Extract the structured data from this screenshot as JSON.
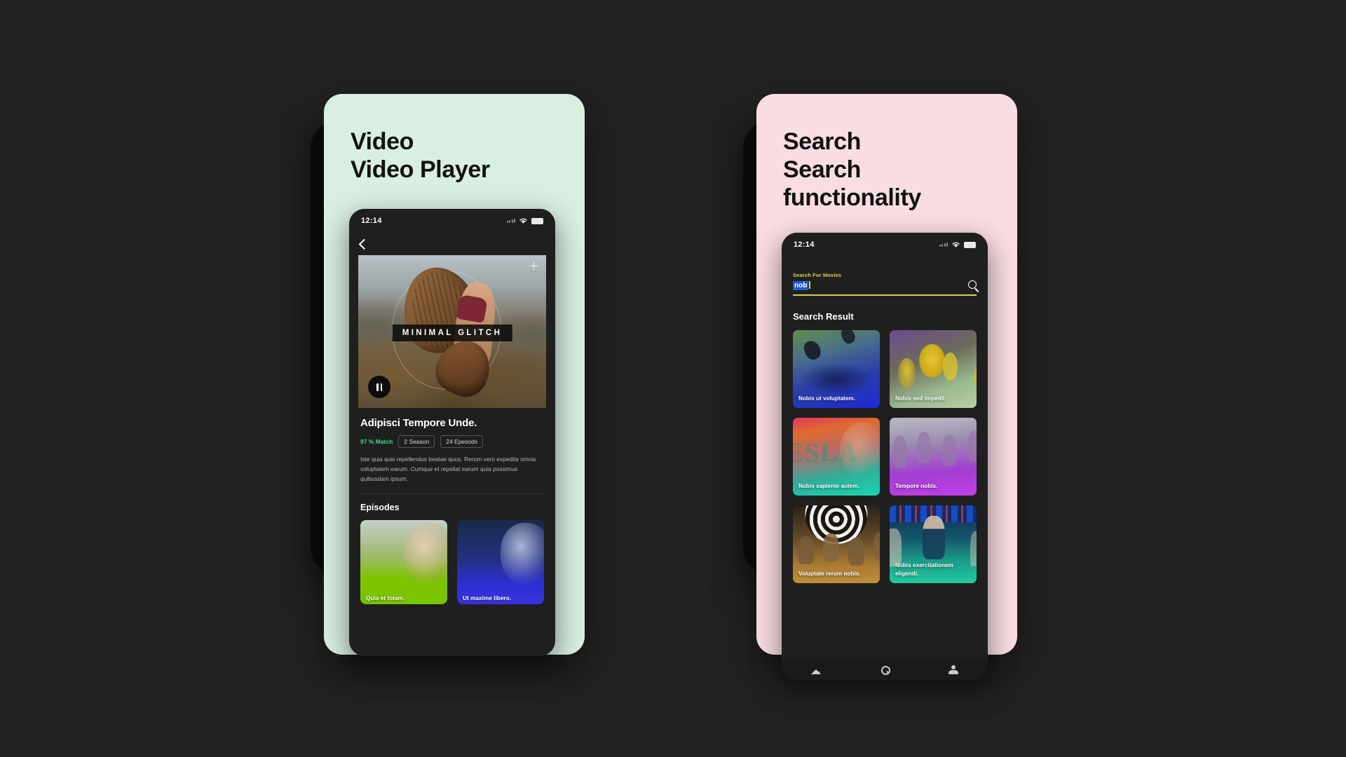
{
  "canvas": {
    "background": "#222222"
  },
  "panels": [
    {
      "id": "video-panel",
      "card_color": "#d9efe2",
      "heading": "Video\nVideo Player",
      "phone": {
        "status": {
          "time": "12:14",
          "signal_icon": "signal-dots-icon",
          "wifi_icon": "wifi-icon",
          "battery_icon": "battery-icon"
        },
        "back_icon": "chevron-left-icon",
        "video": {
          "overlay_title": "MINIMAL GLITCH",
          "play_icon": "pause-icon",
          "plus_icon": "plus-icon"
        },
        "detail": {
          "title": "Adipisci Tempore Unde.",
          "match": "97 % Match",
          "match_color": "#3ddc84",
          "badges": [
            "2 Season",
            "24 Epesods"
          ],
          "description": "Iste quia quis repellendus beatae quos. Rerum vero expedita omnis voluptatem earum. Cumque et repellat earum quia possimus quibusdam ipsum."
        },
        "episodes": {
          "heading": "Episodes",
          "items": [
            {
              "title": "Quia et totam.",
              "theme": "green"
            },
            {
              "title": "Ut maxime libero.",
              "theme": "blue"
            }
          ]
        }
      }
    },
    {
      "id": "search-panel",
      "card_color": "#fadde3",
      "heading": "Search\nSearch\nfunctionality",
      "phone": {
        "status": {
          "time": "12:14",
          "signal_icon": "signal-dots-icon",
          "wifi_icon": "wifi-icon",
          "battery_icon": "battery-icon"
        },
        "search": {
          "label": "Search For Movies",
          "value": "nob",
          "placeholder": "Search For Movies",
          "label_color": "#d8d24a",
          "selection_color": "#1a5fd0",
          "underline_color": "#d8d24a",
          "search_icon": "magnifier-icon"
        },
        "results": {
          "heading": "Search Result",
          "items": [
            {
              "title": "Nobis ut voluptatem."
            },
            {
              "title": "Nobis sed impedit."
            },
            {
              "title": "Nobis sapiente autem."
            },
            {
              "title": "Tempore nobis."
            },
            {
              "title": "Voluptate rerum nobis."
            },
            {
              "title": "Nobis exercitationem eligendi."
            }
          ]
        },
        "bottom_nav": [
          {
            "icon": "home-icon",
            "name": "nav-home"
          },
          {
            "icon": "search-icon",
            "name": "nav-search"
          },
          {
            "icon": "profile-icon",
            "name": "nav-profile"
          }
        ]
      }
    }
  ]
}
